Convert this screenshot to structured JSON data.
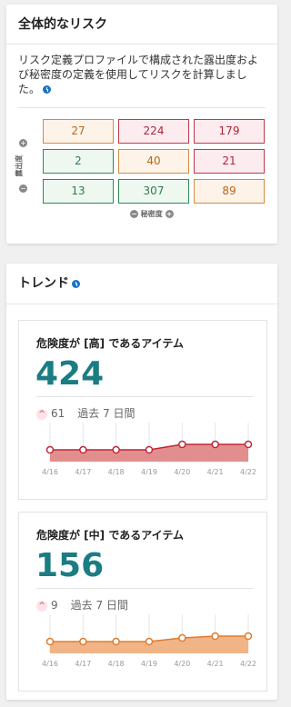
{
  "overall": {
    "title": "全体的なリスク",
    "description": "リスク定義プロファイルで構成された露出度および秘密度の定義を使用してリスクを計算しました。",
    "matrix": [
      [
        {
          "v": "27",
          "level": "med"
        },
        {
          "v": "224",
          "level": "high"
        },
        {
          "v": "179",
          "level": "high"
        }
      ],
      [
        {
          "v": "2",
          "level": "low"
        },
        {
          "v": "40",
          "level": "med"
        },
        {
          "v": "21",
          "level": "high"
        }
      ],
      [
        {
          "v": "13",
          "level": "low"
        },
        {
          "v": "307",
          "level": "low"
        },
        {
          "v": "89",
          "level": "med"
        }
      ]
    ],
    "x_axis_label": "秘密度",
    "y_axis_label": "露出度"
  },
  "trend": {
    "title": "トレンド",
    "high": {
      "title": "危険度が [高] であるアイテム",
      "count": "424",
      "delta": "61",
      "period": "過去 7 日間",
      "color": "#c0263a",
      "fill": "#e38e8e",
      "dates": [
        "4/16",
        "4/17",
        "4/18",
        "4/19",
        "4/20",
        "4/21",
        "4/22"
      ],
      "values": [
        418,
        418,
        418,
        418,
        424,
        424,
        424
      ]
    },
    "medium": {
      "title": "危険度が [中] であるアイテム",
      "count": "156",
      "delta": "9",
      "period": "過去 7 日間",
      "color": "#e07b2e",
      "fill": "#f1b487",
      "dates": [
        "4/16",
        "4/17",
        "4/18",
        "4/19",
        "4/20",
        "4/21",
        "4/22"
      ],
      "values": [
        153,
        153,
        153,
        153,
        155,
        156,
        156
      ]
    }
  }
}
